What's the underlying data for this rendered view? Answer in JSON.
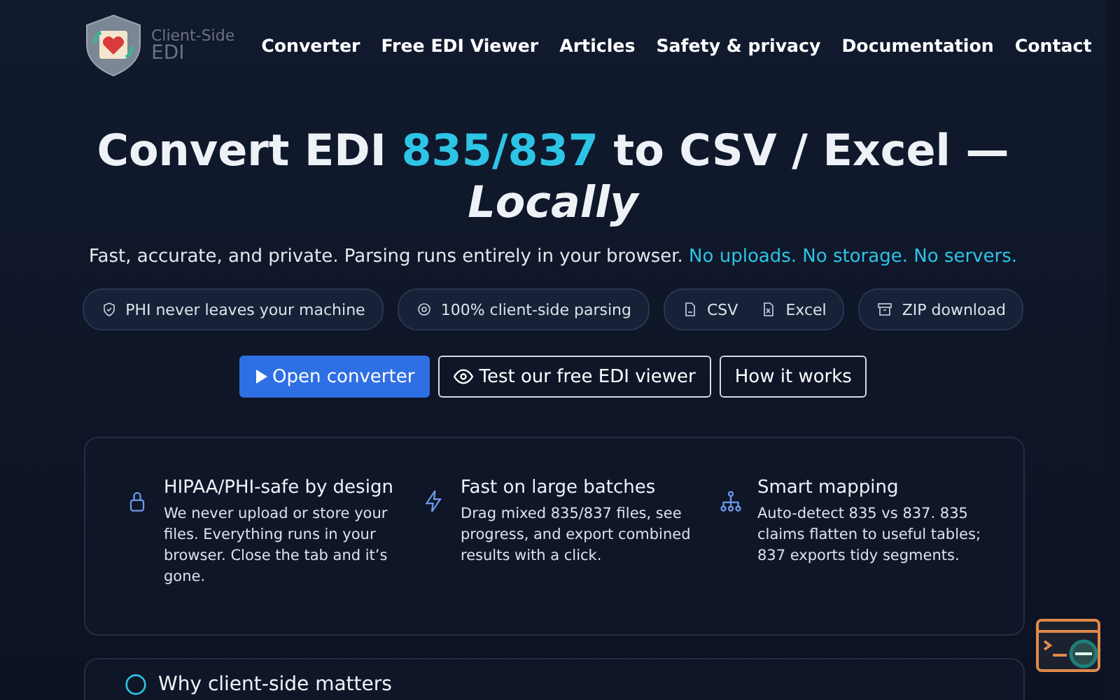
{
  "logo": {
    "line1": "Client-Side",
    "line2": "EDI"
  },
  "nav": [
    "Converter",
    "Free EDI Viewer",
    "Articles",
    "Safety & privacy",
    "Documentation",
    "Contact"
  ],
  "hero": {
    "title_start": "Convert EDI ",
    "title_accent": "835/837",
    "title_end": " to CSV / Excel —",
    "title_italic": "Locally",
    "subtitle": "Fast, accurate, and private. Parsing runs entirely in your browser.",
    "subtitle_accent": "No uploads. No storage. No servers."
  },
  "pills": [
    {
      "kind": "shield",
      "label": "PHI never leaves your machine"
    },
    {
      "kind": "chip",
      "label": "100% client-side parsing"
    },
    {
      "kind": "formats",
      "label": "CSV",
      "label2": "Excel"
    },
    {
      "kind": "archive",
      "label": "ZIP download"
    }
  ],
  "buttons": [
    {
      "kind": "primary",
      "label": "Open converter"
    },
    {
      "kind": "eye",
      "label": "Test our free EDI viewer"
    },
    {
      "kind": "plain",
      "label": "How it works"
    }
  ],
  "features": [
    {
      "kind": "lock",
      "title": "HIPAA/PHI-safe by design",
      "text": "We never upload or store your files. Everything runs in your browser. Close the tab and it’s gone."
    },
    {
      "kind": "bolt",
      "title": "Fast on large batches",
      "text": "Drag mixed 835/837 files, see progress, and export combined results with a click."
    },
    {
      "kind": "tree",
      "title": "Smart mapping",
      "text": "Auto-detect 835 vs 837. 835 claims flatten to useful tables; 837 exports tidy segments."
    }
  ],
  "next_section": {
    "title": "Why client-side matters"
  }
}
